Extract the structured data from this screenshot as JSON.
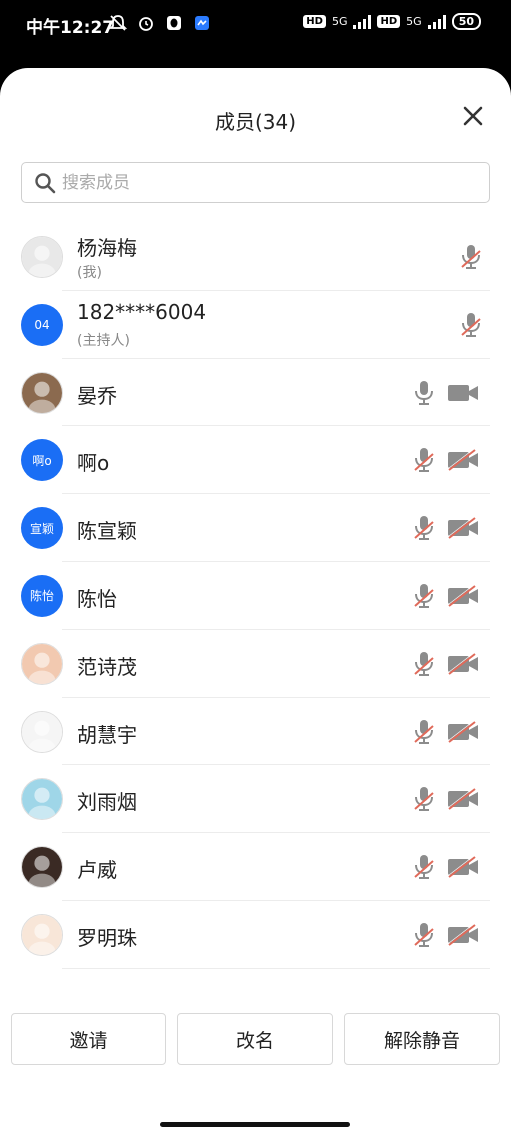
{
  "status": {
    "time": "中午12:27",
    "hd1": "HD",
    "net1": "5G",
    "hd2": "HD",
    "net2": "5G",
    "battery": "50"
  },
  "header": {
    "title": "成员(34)"
  },
  "search": {
    "placeholder": "搜索成员"
  },
  "members": [
    {
      "name": "杨海梅",
      "sub": "(我)",
      "avatar": "photo",
      "mic": "muted",
      "cam": "none"
    },
    {
      "name": "182****6004",
      "sub": "(主持人)",
      "avatar": "blue",
      "avatar_text": "04",
      "mic": "muted",
      "cam": "none"
    },
    {
      "name": "晏乔",
      "avatar": "photo",
      "mic": "on",
      "cam": "on"
    },
    {
      "name": "啊o",
      "avatar": "blue",
      "avatar_text": "啊o",
      "mic": "muted",
      "cam": "off"
    },
    {
      "name": "陈宣颖",
      "avatar": "blue",
      "avatar_text": "宣颖",
      "mic": "muted",
      "cam": "off"
    },
    {
      "name": "陈怡",
      "avatar": "blue",
      "avatar_text": "陈怡",
      "mic": "muted",
      "cam": "off"
    },
    {
      "name": "范诗茂",
      "avatar": "photo",
      "mic": "muted",
      "cam": "off"
    },
    {
      "name": "胡慧宇",
      "avatar": "photo",
      "mic": "muted",
      "cam": "off"
    },
    {
      "name": "刘雨烟",
      "avatar": "photo",
      "mic": "muted",
      "cam": "off"
    },
    {
      "name": "卢威",
      "avatar": "photo",
      "mic": "muted",
      "cam": "off"
    },
    {
      "name": "罗明珠",
      "avatar": "photo",
      "mic": "muted",
      "cam": "off"
    }
  ],
  "actions": {
    "invite": "邀请",
    "rename": "改名",
    "unmute": "解除静音"
  },
  "colors": {
    "accent": "#1a6ef5",
    "muted_slash": "#e06a5a",
    "icon_gray": "#8c8c8c"
  }
}
